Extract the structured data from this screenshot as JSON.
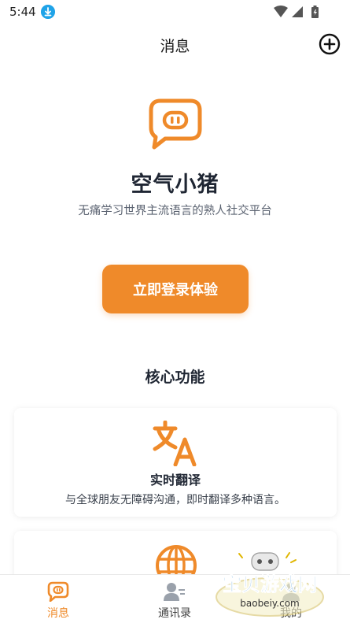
{
  "status_bar": {
    "time": "5:44"
  },
  "header": {
    "title": "消息"
  },
  "brand": {
    "name": "空气小猪",
    "slogan": "无痛学习世界主流语言的熟人社交平台"
  },
  "login": {
    "label": "立即登录体验"
  },
  "features": {
    "section_title": "核心功能",
    "items": [
      {
        "icon": "translate-icon",
        "title": "实时翻译",
        "description": "与全球朋友无障碍沟通，即时翻译多种语言。"
      },
      {
        "icon": "globe-icon"
      }
    ]
  },
  "tabs": [
    {
      "label": "消息",
      "icon": "message-icon",
      "active": true
    },
    {
      "label": "通讯录",
      "icon": "contacts-icon",
      "active": false
    },
    {
      "label": "我的",
      "icon": "profile-icon",
      "active": false
    }
  ],
  "watermark": {
    "title": "宝贝游戏网",
    "url": "baobeiy.com"
  },
  "colors": {
    "accent": "#ef8a2a",
    "text": "#1f2633",
    "download": "#1fa3e8"
  }
}
